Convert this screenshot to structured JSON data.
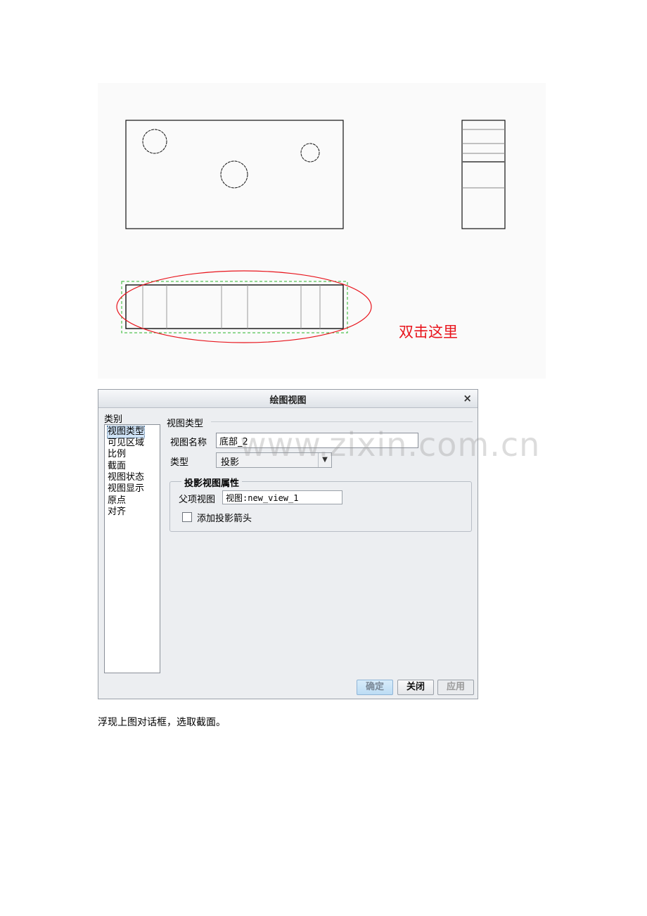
{
  "annotation": "双击这里",
  "dialog": {
    "title": "绘图视图",
    "close_symbol": "×",
    "category_label": "类别",
    "categories": [
      {
        "label": "视图类型",
        "selected": true
      },
      {
        "label": "可见区域"
      },
      {
        "label": "比例"
      },
      {
        "label": "截面"
      },
      {
        "label": "视图状态"
      },
      {
        "label": "视图显示"
      },
      {
        "label": "原点"
      },
      {
        "label": "对齐"
      }
    ],
    "section_title": "视图类型",
    "view_name_label": "视图名称",
    "view_name_value": "底部_2",
    "type_label": "类型",
    "type_value": "投影",
    "projection_group": {
      "title": "投影视图属性",
      "parent_label": "父项视图",
      "parent_value": "视图:new_view_1",
      "arrow_checkbox_label": "添加投影箭头",
      "arrow_checked": false
    },
    "buttons": {
      "ok": "确定",
      "close": "关闭",
      "apply": "应用"
    }
  },
  "watermark": "www.zixin.com.cn",
  "caption": "浮现上图对话框，选取截面。",
  "colors": {
    "annotation": "#e8141c",
    "highlight_ellipse": "#e8141c",
    "selection_box": "#2bb52b"
  }
}
